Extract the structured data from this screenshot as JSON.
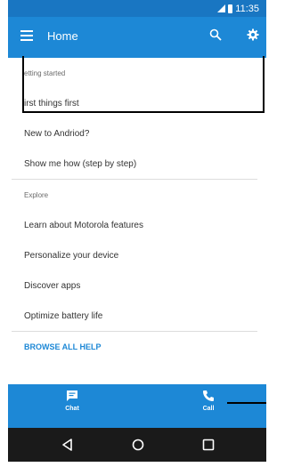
{
  "status_bar": {
    "time": "11:35"
  },
  "app_bar": {
    "title": "Home",
    "menu_icon": "hamburger-menu-icon",
    "search_icon": "search-icon",
    "settings_icon": "gear-icon"
  },
  "sections": {
    "getting_started": {
      "header": "etting started",
      "items": [
        "irst things first",
        "New to Andriod?",
        "Show me how (step by step)"
      ]
    },
    "explore": {
      "header": "Explore",
      "items": [
        "Learn about Motorola features",
        "Personalize your device",
        "Discover apps",
        "Optimize battery life"
      ]
    }
  },
  "browse_all_help": "BROWSE ALL HELP",
  "bottom_bar": {
    "chat_label": "Chat",
    "call_label": "Call"
  },
  "colors": {
    "app_bar": "#1d88d6",
    "status_bar": "#1976c2",
    "nav_bar": "#1a1a1a",
    "link": "#1d88d6"
  }
}
